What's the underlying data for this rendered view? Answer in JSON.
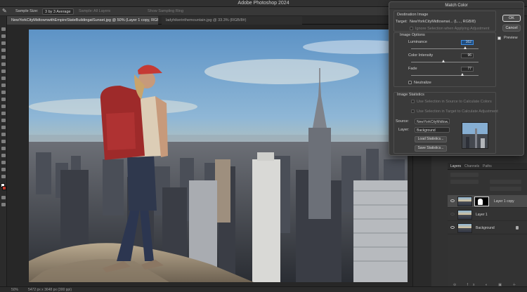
{
  "app": {
    "title": "Adobe Photoshop 2024"
  },
  "options_bar": {
    "sample_size_label": "Sample Size:",
    "sample_size_value": "3 by 3 Average",
    "sample_label": "Sample:",
    "sample_value": "All Layers",
    "show_sampling_ring": "Show Sampling Ring"
  },
  "tabs": [
    {
      "label": "NewYorkCityMidtownwithEmpireStateBuildingatSunset.jpg @ 50% (Layer 1 copy, RGB/8#) *",
      "active": true
    },
    {
      "label": "ladyhikerinthemountain.jpg @ 33.3% (RGB/8#)",
      "active": false
    }
  ],
  "status_bar": {
    "zoom": "50%",
    "doc_info": "5472 px x 3648 px (300 ppi)"
  },
  "layers_panel": {
    "tabs": [
      "Layers",
      "Channels",
      "Paths"
    ],
    "active_tab": "Layers",
    "layers": [
      {
        "name": "Layer 1 copy",
        "selected": true,
        "has_mask": true
      },
      {
        "name": "Layer 1",
        "selected": false,
        "has_mask": false
      },
      {
        "name": "Background",
        "selected": false,
        "has_mask": false,
        "locked": true
      }
    ]
  },
  "dialog": {
    "title": "Match Color",
    "destination_heading": "Destination Image",
    "target_label": "Target:",
    "target_value": "NewYorkCityMidtownwi... (L..., RGB/8)",
    "ignore_selection": "Ignore Selection when Applying Adjustment",
    "image_options_heading": "Image Options",
    "luminance_label": "Luminance",
    "luminance_value": "162",
    "luminance_fraction": 0.81,
    "intensity_label": "Color Intensity",
    "intensity_value": "96",
    "intensity_fraction": 0.48,
    "fade_label": "Fade",
    "fade_value": "77",
    "fade_fraction": 0.77,
    "neutralize_label": "Neutralize",
    "image_statistics_heading": "Image Statistics",
    "use_sel_source": "Use Selection in Source to Calculate Colors",
    "use_sel_target": "Use Selection in Target to Calculate Adjustment",
    "source_label": "Source:",
    "source_value": "NewYorkCityMidtow...",
    "layer_label": "Layer:",
    "layer_value": "Background",
    "load_stats": "Load Statistics...",
    "save_stats": "Save Statistics...",
    "ok_label": "OK",
    "cancel_label": "Cancel",
    "preview_label": "Preview"
  }
}
